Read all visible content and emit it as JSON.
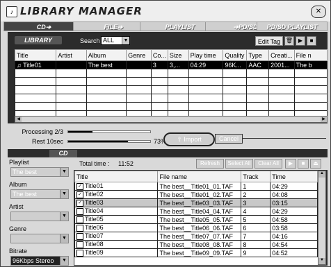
{
  "app": {
    "title": "LIBRARY MANAGER",
    "icon_glyph": "♪",
    "close_glyph": "✕"
  },
  "tabs": [
    "CD➔",
    "FILE➔",
    "PLAYLIST",
    "➔PD/SD",
    "PD/SD PLAYLIST"
  ],
  "library": {
    "label": "LIBRARY",
    "search_label": "Search",
    "search_value": "ALL",
    "edit_tag_label": "Edit Tag",
    "columns": [
      "Title",
      "Artist",
      "Album",
      "Genre",
      "Co...",
      "Size",
      "Play time",
      "Quality",
      "Type",
      "Creati...",
      "File n"
    ],
    "rows": [
      [
        "Title01",
        "",
        "The best",
        "",
        "3",
        "3,...",
        "04:29",
        "96K...",
        "AAC",
        "2001...",
        "The b"
      ]
    ],
    "empty_rows": 6
  },
  "progress": {
    "processing_label": "Processing 2/3",
    "processing_fraction": 0.3,
    "rest_label": "Rest 10sec",
    "rest_fraction": 0.73,
    "rest_pct_text": "73%",
    "import_label": "Import",
    "cancel_label": "Cancel"
  },
  "cd": {
    "label": "CD",
    "total_time_label": "Total time :",
    "total_time_value": "11:52",
    "buttons": [
      "Refresh",
      "Select All",
      "Clear All"
    ],
    "side": {
      "playlist_label": "Playlist",
      "playlist_value": "The best",
      "album_label": "Album",
      "album_value": "The best",
      "artist_label": "Artist",
      "artist_value": "",
      "genre_label": "Genre",
      "genre_value": "",
      "bitrate_label": "Bitrate",
      "bitrate_value": "96Kbps Stereo"
    },
    "columns": [
      "Title",
      "File name",
      "Track",
      "Time"
    ],
    "tracks": [
      {
        "checked": true,
        "title": "Title01",
        "file": "The best__Title01_01.TAF",
        "track": "1",
        "time": "04:29"
      },
      {
        "checked": true,
        "title": "Title02",
        "file": "The best__Title01_02.TAF",
        "track": "2",
        "time": "04:08"
      },
      {
        "checked": true,
        "title": "Title03",
        "file": "The best__Title03_03.TAF",
        "track": "3",
        "time": "03:15"
      },
      {
        "checked": false,
        "title": "Title04",
        "file": "The best__Title04_04.TAF",
        "track": "4",
        "time": "04:29"
      },
      {
        "checked": false,
        "title": "Title05",
        "file": "The best__Title05_05.TAF",
        "track": "5",
        "time": "04:58"
      },
      {
        "checked": false,
        "title": "Title06",
        "file": "The best__Title06_06.TAF",
        "track": "6",
        "time": "03:58"
      },
      {
        "checked": false,
        "title": "Title07",
        "file": "The best__Title07_07.TAF",
        "track": "7",
        "time": "04:16"
      },
      {
        "checked": false,
        "title": "Title08",
        "file": "The best__Title08_08.TAF",
        "track": "8",
        "time": "04:54"
      },
      {
        "checked": false,
        "title": "Title09",
        "file": "The best__Title09_09.TAF",
        "track": "9",
        "time": "04:52"
      }
    ],
    "highlighted_track": 3
  }
}
